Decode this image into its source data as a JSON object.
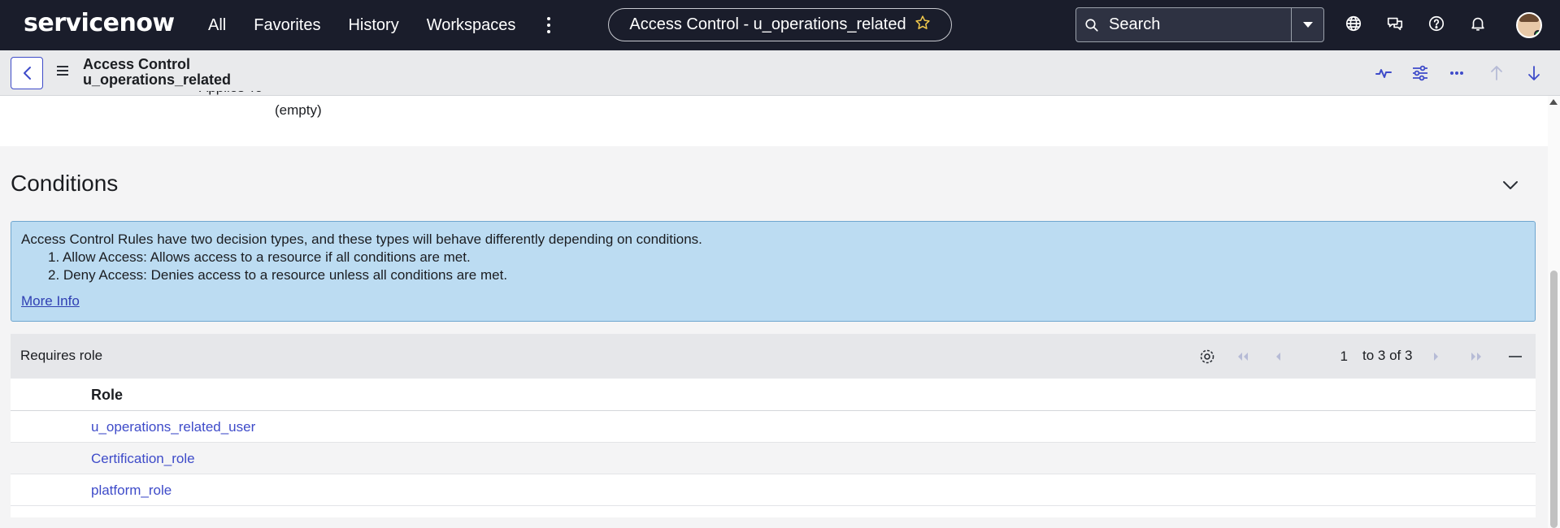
{
  "nav": {
    "logo": "servicenow",
    "links": [
      "All",
      "Favorites",
      "History",
      "Workspaces"
    ],
    "record_title": "Access Control - u_operations_related",
    "search_placeholder": "Search",
    "icons": [
      "globe-icon",
      "chat-icon",
      "help-icon",
      "bell-icon"
    ]
  },
  "header": {
    "type": "Access Control",
    "name": "u_operations_related",
    "icons": [
      "activity-icon",
      "sliders-icon",
      "more-icon",
      "arrow-up-icon",
      "arrow-down-icon"
    ]
  },
  "form": {
    "applies_to_label": "Applies To",
    "applies_to_value": "(empty)"
  },
  "conditions": {
    "title": "Conditions",
    "info": {
      "intro": "Access Control Rules have two decision types, and these types will behave differently depending on conditions.",
      "items": [
        "1. Allow Access: Allows access to a resource if all conditions are met.",
        "2. Deny Access: Denies access to a resource unless all conditions are met."
      ],
      "link": "More Info"
    }
  },
  "related_list": {
    "title": "Requires role",
    "page": "1",
    "page_text": "to 3 of 3",
    "column": "Role",
    "rows": [
      "u_operations_related_user",
      "Certification_role",
      "platform_role"
    ]
  },
  "colors": {
    "nav_bg": "#1a1d2b",
    "link": "#3e4bc9",
    "info_bg": "#bcdcf2"
  }
}
